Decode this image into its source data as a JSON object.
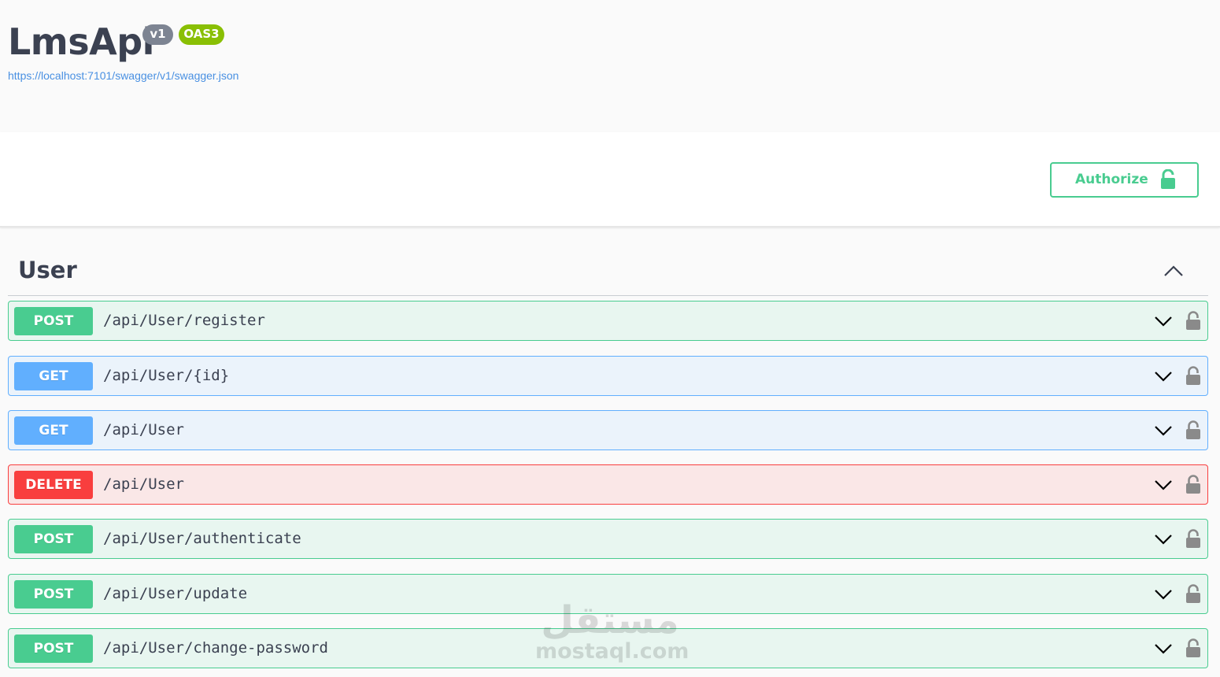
{
  "info": {
    "title": "LmsApi",
    "version_badge": "v1",
    "oas_badge": "OAS3",
    "spec_url": "https://localhost:7101/swagger/v1/swagger.json"
  },
  "auth": {
    "authorize_label": "Authorize",
    "icon": "unlocked-lock-icon"
  },
  "tag": {
    "name": "User",
    "toggle_icon": "chevron-up-icon"
  },
  "operations": [
    {
      "method": "POST",
      "path": "/api/User/register"
    },
    {
      "method": "GET",
      "path": "/api/User/{id}"
    },
    {
      "method": "GET",
      "path": "/api/User"
    },
    {
      "method": "DELETE",
      "path": "/api/User"
    },
    {
      "method": "POST",
      "path": "/api/User/authenticate"
    },
    {
      "method": "POST",
      "path": "/api/User/update"
    },
    {
      "method": "POST",
      "path": "/api/User/change-password"
    }
  ],
  "colors": {
    "post": "#49cc90",
    "get": "#61affe",
    "delete": "#f93e3e",
    "oas_badge": "#89bf04",
    "version_badge": "#7d8492",
    "link": "#4990e2"
  },
  "watermark": {
    "arabic": "مستقل",
    "latin": "mostaql.com"
  }
}
